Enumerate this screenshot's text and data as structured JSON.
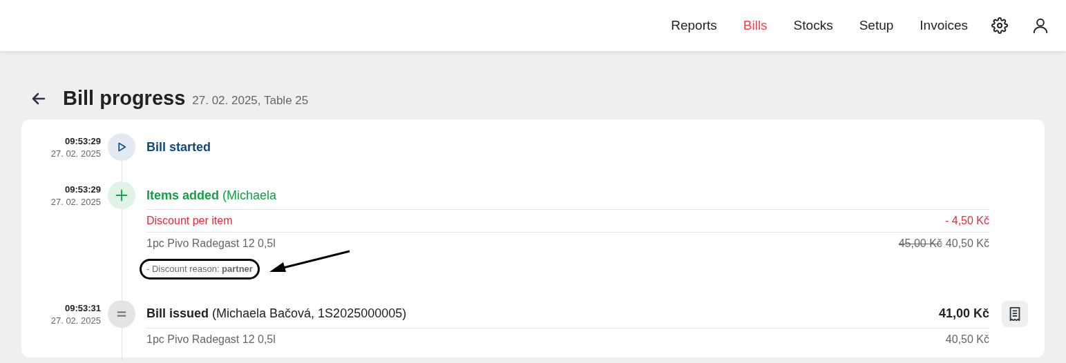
{
  "nav": {
    "items": [
      {
        "label": "Reports",
        "selected": false
      },
      {
        "label": "Bills",
        "selected": true
      },
      {
        "label": "Stocks",
        "selected": false
      },
      {
        "label": "Setup",
        "selected": false
      },
      {
        "label": "Invoices",
        "selected": false
      }
    ]
  },
  "page": {
    "title": "Bill progress",
    "subtitle": "27. 02. 2025, Table 25"
  },
  "events": [
    {
      "kind": "started",
      "time": "09:53:29",
      "date": "27. 02. 2025",
      "title": "Bill started"
    },
    {
      "kind": "added",
      "time": "09:53:29",
      "date": "27. 02. 2025",
      "title": "**Items added** (Michaela",
      "lines": [
        {
          "kind": "discount",
          "label": "Discount per item",
          "price": "- 4,50 Kč"
        },
        {
          "kind": "item",
          "label": "1pc Pivo Radegast 12 0,5l",
          "old_price": "45,00 Kč",
          "price": "40,50 Kč"
        },
        {
          "kind": "note",
          "text": "- Discount reason: **partner**",
          "highlighted": true
        }
      ]
    },
    {
      "kind": "issued",
      "time": "09:53:31",
      "date": "27. 02. 2025",
      "title": "**Bill issued** (Michaela Bačová, 1S2025000005)",
      "amount": "41,00 Kč",
      "lines": [
        {
          "kind": "item",
          "label": "1pc Pivo Radegast 12 0,5l",
          "price": "40,50 Kč"
        }
      ]
    }
  ]
}
